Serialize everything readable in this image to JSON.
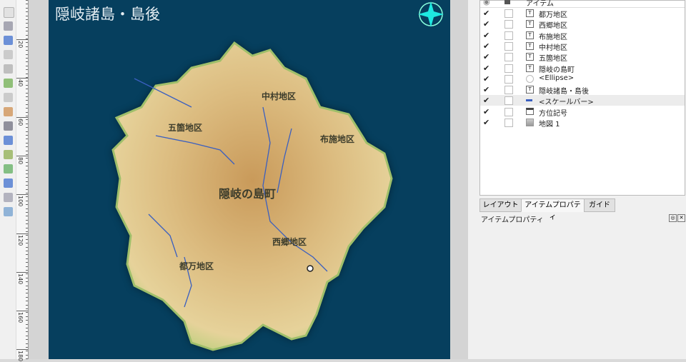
{
  "ruler": {
    "labels": [
      "20",
      "40",
      "60",
      "80",
      "100",
      "120",
      "140",
      "160",
      "180"
    ]
  },
  "toolbar": {
    "tools": [
      "select-icon",
      "move-content-icon",
      "edit-nodes-icon",
      "add-map-icon",
      "add-3d-map-icon",
      "add-picture-icon",
      "add-label-icon",
      "add-legend-icon",
      "add-scalebar-icon",
      "add-text-icon",
      "add-shape-icon",
      "add-line-icon",
      "add-polygon-icon",
      "add-table-icon",
      "add-attribute-table-icon"
    ]
  },
  "map": {
    "title": "隠岐諸島・島後",
    "background": "#063f5e",
    "labels": {
      "nakamura": "中村地区",
      "goka": "五箇地区",
      "fuse": "布施地区",
      "town": "隠岐の島町",
      "saigo": "西郷地区",
      "tsuma": "都万地区"
    }
  },
  "items_panel": {
    "header": "アイテム",
    "items": [
      {
        "name": "都万地区",
        "type": "T",
        "visible": true,
        "locked": false
      },
      {
        "name": "西郷地区",
        "type": "T",
        "visible": true,
        "locked": false
      },
      {
        "name": "布施地区",
        "type": "T",
        "visible": true,
        "locked": false
      },
      {
        "name": "中村地区",
        "type": "T",
        "visible": true,
        "locked": false
      },
      {
        "name": "五箇地区",
        "type": "T",
        "visible": true,
        "locked": false
      },
      {
        "name": "隠岐の島町",
        "type": "T",
        "visible": true,
        "locked": false
      },
      {
        "name": "<Ellipse>",
        "type": "ellipse",
        "visible": true,
        "locked": false
      },
      {
        "name": "隠岐諸島・島後",
        "type": "T",
        "visible": true,
        "locked": false
      },
      {
        "name": "<スケールバー>",
        "type": "scalebar",
        "visible": true,
        "locked": false
      },
      {
        "name": "方位記号",
        "type": "picture",
        "visible": true,
        "locked": false
      },
      {
        "name": "地図 1",
        "type": "map",
        "visible": true,
        "locked": false
      }
    ]
  },
  "tabs": [
    {
      "label": "レイアウト"
    },
    {
      "label": "アイテムプロパティ",
      "active": true
    },
    {
      "label": "ガイド"
    }
  ],
  "properties": {
    "title": "アイテムプロパティ"
  }
}
